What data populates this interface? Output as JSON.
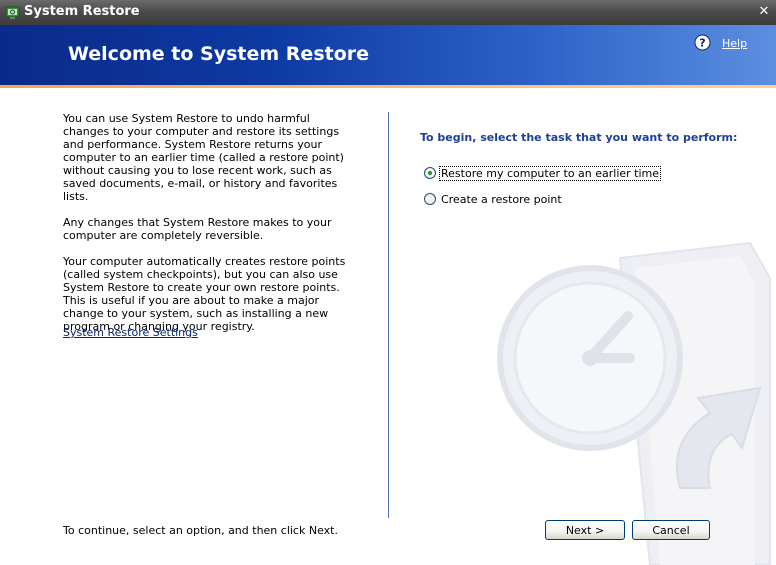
{
  "window": {
    "title": "System Restore",
    "close_symbol": "✕"
  },
  "banner": {
    "title": "Welcome to System Restore",
    "help_label": "Help",
    "help_icon": "help-icon"
  },
  "intro": {
    "paragraphs": [
      "You can use System Restore to undo harmful changes to your computer and restore its settings and performance. System Restore returns your computer to an earlier time (called a restore point) without causing you to lose recent work, such as saved documents, e-mail, or history and favorites lists.",
      "Any changes that System Restore makes to your computer are completely reversible.",
      "Your computer automatically creates restore points (called system checkpoints), but you can also use System Restore to create your own restore points. This is useful if you are about to make a major change to your system, such as installing a new program or changing your registry."
    ],
    "settings_link": "System Restore Settings"
  },
  "tasks": {
    "heading": "To begin, select the task that you want to perform:",
    "options": [
      {
        "label": "Restore my computer to an earlier time",
        "checked": true
      },
      {
        "label": "Create a restore point",
        "checked": false
      }
    ]
  },
  "footer": {
    "instruction": "To continue, select an option, and then click Next.",
    "next_label": "Next >",
    "cancel_label": "Cancel"
  },
  "colors": {
    "banner_dark": "#0a2a8a",
    "banner_light": "#5c8fe0",
    "accent_line": "#f5a64a",
    "heading_blue": "#1f3f9a",
    "divider": "#4e6fb5"
  }
}
